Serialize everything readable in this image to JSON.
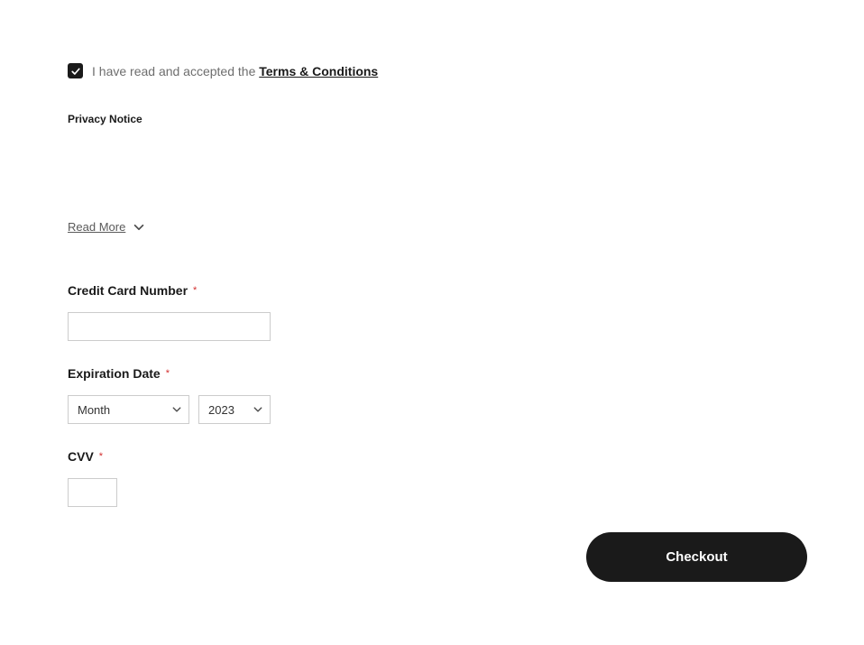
{
  "terms": {
    "checkbox_checked": true,
    "prefix_text": "I have read and accepted the ",
    "link_text": "Terms & Conditions"
  },
  "privacy": {
    "title": "Privacy Notice",
    "read_more": "Read More"
  },
  "credit_card": {
    "label": "Credit Card Number",
    "value": ""
  },
  "expiration": {
    "label": "Expiration Date",
    "month_placeholder": "Month",
    "year_value": "2023"
  },
  "cvv": {
    "label": "CVV",
    "value": ""
  },
  "checkout": {
    "label": "Checkout"
  },
  "required_mark": "*"
}
